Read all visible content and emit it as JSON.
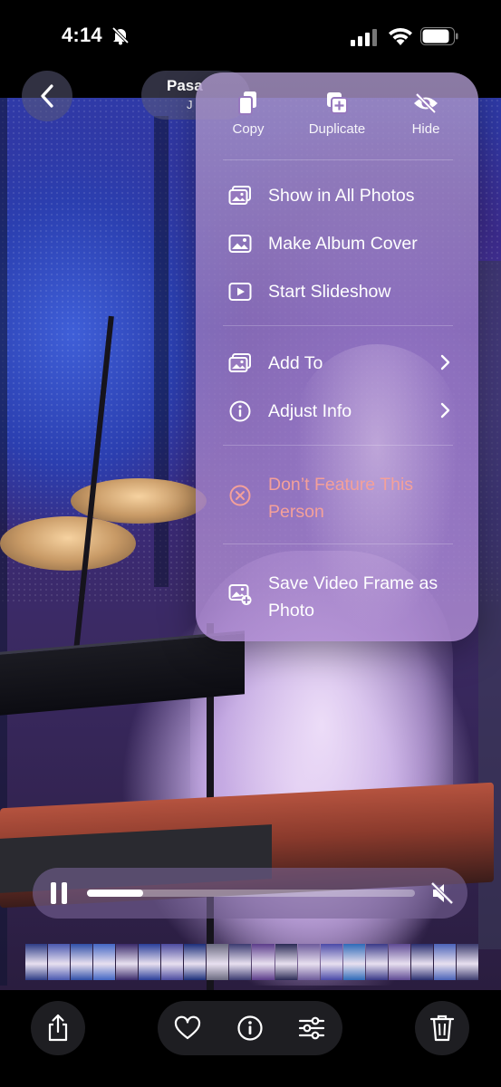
{
  "status_bar": {
    "time": "4:14"
  },
  "nav": {
    "title": "Pasa",
    "subtitle": "J"
  },
  "menu": {
    "quick_actions": [
      {
        "label": "Copy",
        "icon": "copy-icon"
      },
      {
        "label": "Duplicate",
        "icon": "duplicate-icon"
      },
      {
        "label": "Hide",
        "icon": "hide-icon"
      }
    ],
    "items": [
      {
        "label": "Show in All Photos",
        "icon": "photos-stack-icon"
      },
      {
        "label": "Make Album Cover",
        "icon": "photo-icon"
      },
      {
        "label": "Start Slideshow",
        "icon": "play-rectangle-icon"
      },
      {
        "label": "Add To",
        "icon": "photos-stack-icon",
        "has_submenu": true
      },
      {
        "label": "Adjust Info",
        "icon": "info-circle-icon",
        "has_submenu": true
      },
      {
        "label": "Don’t Feature This Person",
        "icon": "x-circle-icon",
        "destructive": true
      },
      {
        "label": "Save Video Frame as Photo",
        "icon": "photo-add-icon"
      }
    ]
  },
  "player": {
    "progress": 0.17,
    "muted": true
  },
  "colors": {
    "destructive_text": "#f4a09a",
    "menu_bg": "#9a80c4",
    "toolbar_button_bg": "#1e1e22"
  },
  "filmstrip_colors": [
    "#2e3d86",
    "#4a58b0",
    "#2f4fa8",
    "#4366c4",
    "#3a2a6a",
    "#2a3f9a",
    "#4c4ba0",
    "#1c2f7a",
    "#6a6a80",
    "#3b3b70",
    "#5b3c8a",
    "#2a2a55",
    "#6c5a9a",
    "#4a4aa8",
    "#2e6ab8",
    "#3a3a88",
    "#5e4a94",
    "#2a2f70",
    "#4a62b8",
    "#3c3c6e"
  ]
}
